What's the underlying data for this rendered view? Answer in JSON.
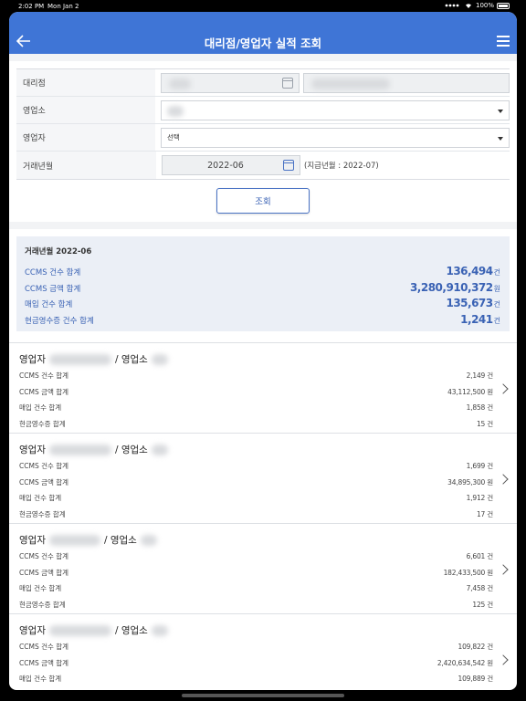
{
  "status": {
    "time": "2:02 PM",
    "date": "Mon Jan 2",
    "battery": "100%"
  },
  "header": {
    "title": "대리점/영업자 실적 조회"
  },
  "form": {
    "agency_label": "대리점",
    "office_label": "영업소",
    "salesperson_label": "영업자",
    "salesperson_value": "선택",
    "month_label": "거래년월",
    "month_value": "2022-06",
    "payment_hint": "(지급년월 : 2022-07)",
    "search_button": "조회"
  },
  "summary": {
    "heading": "거래년월  2022-06",
    "rows": [
      {
        "label": "CCMS 건수 합계",
        "value": "136,494",
        "unit": "건"
      },
      {
        "label": "CCMS 금액 합계",
        "value": "3,280,910,372",
        "unit": "원"
      },
      {
        "label": "매입 건수 합계",
        "value": "135,673",
        "unit": "건"
      },
      {
        "label": "현금영수증 건수 합계",
        "value": "1,241",
        "unit": "건"
      }
    ]
  },
  "cards": [
    {
      "title_a": "영업자",
      "title_b": "/ 영업소",
      "rows": [
        {
          "label": "CCMS 건수 합계",
          "value": "2,149 건"
        },
        {
          "label": "CCMS 금액 합계",
          "value": "43,112,500 원"
        },
        {
          "label": "매입 건수 합계",
          "value": "1,858 건"
        },
        {
          "label": "현금영수증 합계",
          "value": "15 건"
        }
      ]
    },
    {
      "title_a": "영업자",
      "title_b": "/ 영업소",
      "rows": [
        {
          "label": "CCMS 건수 합계",
          "value": "1,699 건"
        },
        {
          "label": "CCMS 금액 합계",
          "value": "34,895,300 원"
        },
        {
          "label": "매입 건수 합계",
          "value": "1,912 건"
        },
        {
          "label": "현금영수증 합계",
          "value": "17 건"
        }
      ]
    },
    {
      "title_a": "영업자",
      "title_b": "/ 영업소",
      "rows": [
        {
          "label": "CCMS 건수 합계",
          "value": "6,601 건"
        },
        {
          "label": "CCMS 금액 합계",
          "value": "182,433,500 원"
        },
        {
          "label": "매입 건수 합계",
          "value": "7,458 건"
        },
        {
          "label": "현금영수증 합계",
          "value": "125 건"
        }
      ]
    },
    {
      "title_a": "영업자",
      "title_b": "/ 영업소",
      "rows": [
        {
          "label": "CCMS 건수 합계",
          "value": "109,822 건"
        },
        {
          "label": "CCMS 금액 합계",
          "value": "2,420,634,542 원"
        },
        {
          "label": "매입 건수 합계",
          "value": "109,889 건"
        }
      ]
    }
  ],
  "colors": {
    "accent": "#3f75d6",
    "value_blue": "#3a62b4"
  }
}
